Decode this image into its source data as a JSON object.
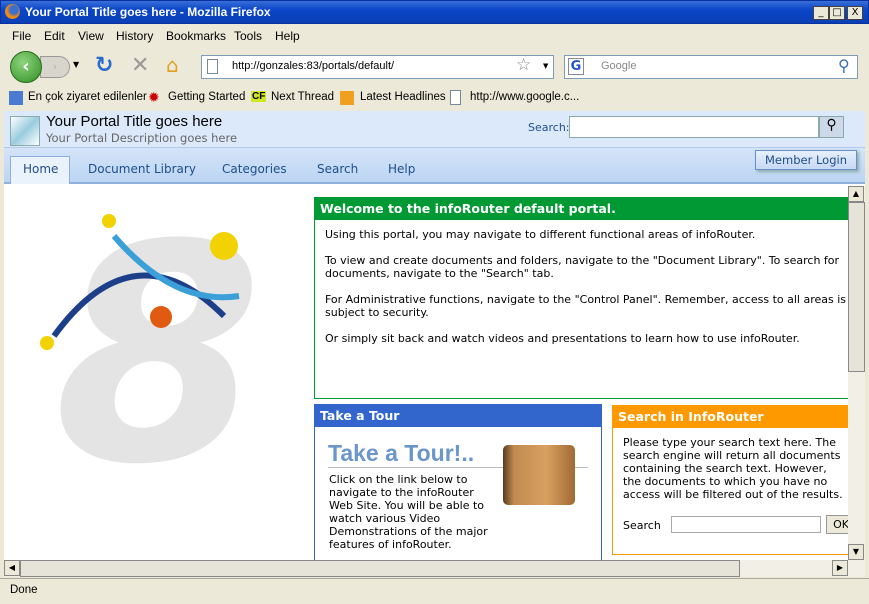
{
  "window": {
    "title": "Your Portal Title goes here - Mozilla Firefox",
    "min": "_",
    "max": "□",
    "close": "X"
  },
  "menu": [
    "File",
    "Edit",
    "View",
    "History",
    "Bookmarks",
    "Tools",
    "Help"
  ],
  "nav": {
    "url": "http://gonzales:83/portals/default/",
    "search_placeholder": "Google"
  },
  "bookmarks": [
    "En çok ziyaret edilenler",
    "Getting Started",
    "Next Thread",
    "Latest Headlines",
    "http://www.google.c..."
  ],
  "portal": {
    "title": "Your Portal Title goes here",
    "description": "Your Portal Description goes here",
    "search_label": "Search:",
    "member_login": "Member Login",
    "tabs": [
      "Home",
      "Document Library",
      "Categories",
      "Search",
      "Help"
    ],
    "active_tab": "Home"
  },
  "welcome": {
    "title": "Welcome to the infoRouter default portal.",
    "paragraphs": [
      "Using this portal, you may navigate to different functional areas of infoRouter.",
      "To view and create documents and folders, navigate to the \"Document Library\". To search for documents, navigate to the \"Search\" tab.",
      "For Administrative functions, navigate to the \"Control Panel\". Remember, access to all areas is subject to security.",
      "Or simply sit back and watch videos and presentations to learn how to use infoRouter."
    ]
  },
  "tour": {
    "title": "Take a Tour",
    "banner": "Take a Tour!..",
    "text": "Click on the link below to navigate to the infoRouter Web Site. You will be able to watch various Video Demonstrations of the major features of infoRouter."
  },
  "search_box": {
    "title": "Search in InfoRouter",
    "text": "Please type your search text here. The search engine will return all documents containing the search text. However, the documents to which you have no access will be filtered out of the results.",
    "label": "Search",
    "ok": "OK"
  },
  "status": "Done",
  "colors": {
    "welcome": "#009933",
    "tour": "#3366cc",
    "search": "#ff9900"
  }
}
